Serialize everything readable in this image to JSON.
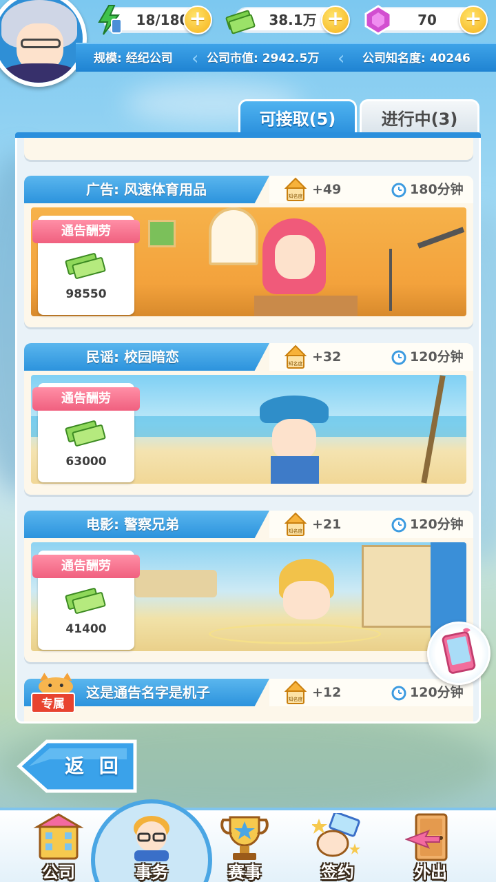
{
  "resources": {
    "energy": "18/180",
    "money": "38.1万",
    "gems": "70"
  },
  "company": {
    "scale": "规模: 经纪公司",
    "market_value": "公司市值: 2942.5万",
    "fame": "公司知名度: 40246"
  },
  "tabs": {
    "available": "可接取(5)",
    "in_progress": "进行中(3)"
  },
  "labels": {
    "reward": "通告酬劳",
    "fame_badge": "知名度",
    "exclusive": "专属"
  },
  "jobs": [
    {
      "title": "广告: 风速体育用品",
      "fame": "+49",
      "time": "180分钟",
      "reward": "98550"
    },
    {
      "title": "民谣: 校园暗恋",
      "fame": "+32",
      "time": "120分钟",
      "reward": "63000"
    },
    {
      "title": "电影: 警察兄弟",
      "fame": "+21",
      "time": "120分钟",
      "reward": "41400"
    },
    {
      "title": "这是通告名字是机子",
      "fame": "+12",
      "time": "120分钟"
    }
  ],
  "back_label": "返 回",
  "nav": {
    "company": "公司",
    "affairs": "事务",
    "events": "赛事",
    "sign": "签约",
    "outing": "外出"
  },
  "colors": {
    "primary_blue": "#2c93dd",
    "reward_pink": "#f0607f",
    "plus_gold": "#f6b21b",
    "exclusive_red": "#e8432f"
  }
}
